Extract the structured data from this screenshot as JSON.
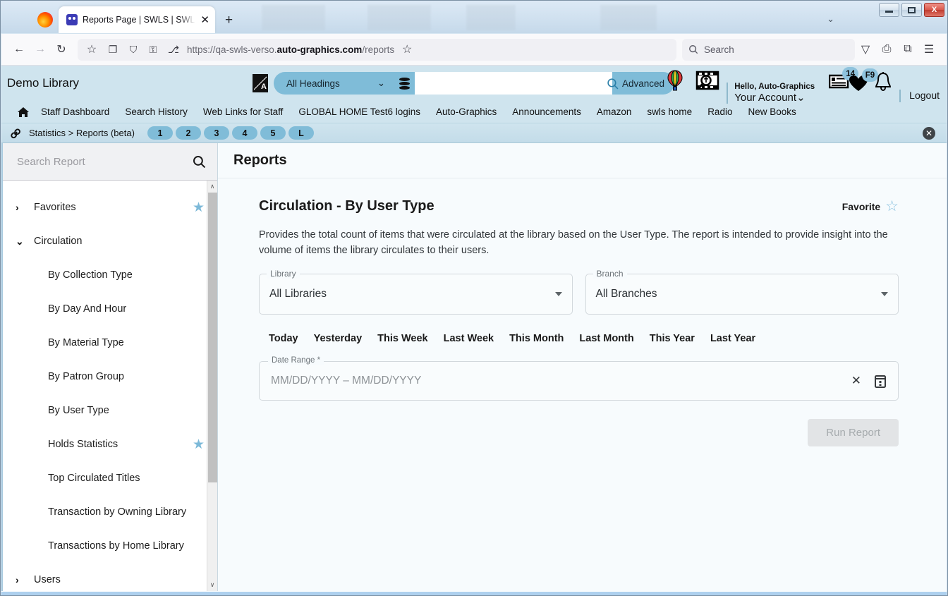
{
  "window": {
    "minimize_label": "Minimize",
    "maximize_label": "Maximize",
    "close_label": "X"
  },
  "browser": {
    "tab": {
      "title": "Reports Page | SWLS | SWLS | Au",
      "close_label": "✕",
      "favicon_name": "swls-favicon"
    },
    "new_tab_label": "+",
    "tab_list_chevron": "⌄",
    "toolbar": {
      "back_label": "←",
      "forward_label": "→",
      "reload_label": "↻",
      "bookmark_label": "☆",
      "save_to_pocket_label": "❐",
      "shield_label": "⛉",
      "lock_label": "⚿",
      "permissions_label": "⎇",
      "url_prefix": "https://qa-swls-verso.",
      "url_domain": "auto-graphics.com",
      "url_path": "/reports",
      "star_label": "☆",
      "search_placeholder": "Search",
      "search_icon": "search-icon",
      "pocket_label": "▽",
      "print_label": "⎙",
      "extensions_label": "⧉",
      "menu_label": "☰"
    }
  },
  "app_header": {
    "library_name": "Demo Library",
    "alpha_browse_icon": "alpha-browse-icon",
    "heading_select": {
      "value": "All Headings",
      "caret": "⌄"
    },
    "database_icon": "database-icon",
    "search_value": "",
    "search_placeholder": "",
    "search_icon": "magnifier-icon",
    "advanced_label": "Advanced",
    "account": {
      "balloon_icon": "hot-air-balloon-icon",
      "film_search_icon": "film-search-icon",
      "hello": "Hello, Auto-Graphics",
      "account_link": "Your Account⌄",
      "cards_icon": "saved-list-icon",
      "cards_badge": "14",
      "heart_icon": "heart-icon",
      "heart_badge": "F9",
      "bell_icon": "bell-icon",
      "logout_label": "Logout"
    }
  },
  "app_nav": {
    "home_icon": "home-icon",
    "links": [
      "Staff Dashboard",
      "Search History",
      "Web Links for Staff",
      "GLOBAL HOME Test6 logins",
      "Auto-Graphics",
      "Announcements",
      "Amazon",
      "swls home",
      "Radio",
      "New Books"
    ]
  },
  "breadcrumb": {
    "chain_icon": "chain-link-icon",
    "text": "Statistics > Reports (beta)",
    "pills": [
      "1",
      "2",
      "3",
      "4",
      "5",
      "L"
    ],
    "close_label": "✕"
  },
  "sidebar": {
    "search_placeholder": "Search Report",
    "search_value": "",
    "search_icon": "search-icon",
    "tree": [
      {
        "label": "Favorites",
        "caret": "›",
        "level": 0,
        "starred": true
      },
      {
        "label": "Circulation",
        "caret": "⌄",
        "level": 0,
        "starred": false
      },
      {
        "label": "By Collection Type",
        "caret": "",
        "level": 1,
        "starred": false
      },
      {
        "label": "By Day And Hour",
        "caret": "",
        "level": 1,
        "starred": false
      },
      {
        "label": "By Material Type",
        "caret": "",
        "level": 1,
        "starred": false
      },
      {
        "label": "By Patron Group",
        "caret": "",
        "level": 1,
        "starred": false
      },
      {
        "label": "By User Type",
        "caret": "",
        "level": 1,
        "starred": false
      },
      {
        "label": "Holds Statistics",
        "caret": "",
        "level": 1,
        "starred": true
      },
      {
        "label": "Top Circulated Titles",
        "caret": "",
        "level": 1,
        "starred": false
      },
      {
        "label": "Transaction by Owning Library",
        "caret": "",
        "level": 1,
        "starred": false
      },
      {
        "label": "Transactions by Home Library",
        "caret": "",
        "level": 1,
        "starred": false
      },
      {
        "label": "Users",
        "caret": "›",
        "level": 0,
        "starred": false
      }
    ],
    "scrollbar": {
      "up": "∧",
      "down": "∨"
    }
  },
  "main": {
    "page_title": "Reports",
    "report_title": "Circulation - By User Type",
    "favorite_label": "Favorite",
    "favorite_star": "☆",
    "description": "Provides the total count of items that were circulated at the library based on the User Type. The report is intended to provide insight into the volume of items the library circulates to their users.",
    "library_field": {
      "legend": "Library",
      "value": "All Libraries"
    },
    "branch_field": {
      "legend": "Branch",
      "value": "All Branches"
    },
    "date_presets": [
      "Today",
      "Yesterday",
      "This Week",
      "Last Week",
      "This Month",
      "Last Month",
      "This Year",
      "Last Year"
    ],
    "date_range": {
      "legend": "Date Range *",
      "placeholder": "MM/DD/YYYY – MM/DD/YYYY",
      "value": "",
      "clear_icon": "✕",
      "calendar_icon": "calendar-icon"
    },
    "run_button": "Run Report"
  },
  "colors": {
    "app_header_bg": "#cfe4ee",
    "accent_blue": "#7fbcd8",
    "pill_blue": "#80bcd8",
    "star_blue": "#7cb9d8",
    "main_bg": "#f7fbfd",
    "bottom_strip": "#aed0ee"
  }
}
